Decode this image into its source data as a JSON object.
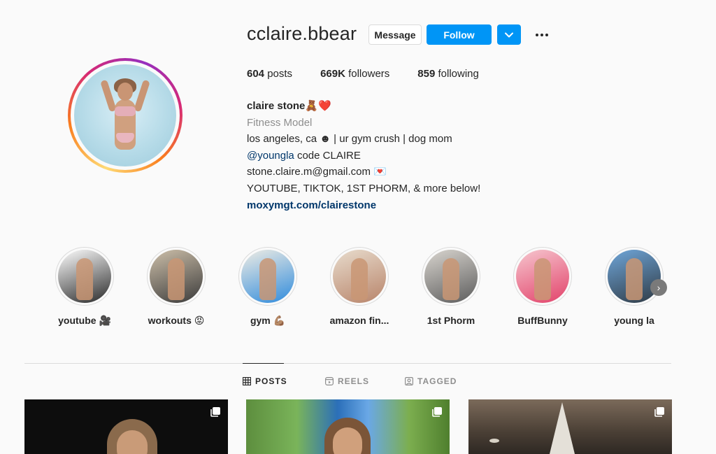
{
  "profile": {
    "username": "cclaire.bbear",
    "message_label": "Message",
    "follow_label": "Follow",
    "dropdown_icon": "chevron-down-icon",
    "more_icon": "more-options-icon"
  },
  "stats": {
    "posts_count": "604",
    "posts_label": "posts",
    "followers_count": "669K",
    "followers_label": "followers",
    "following_count": "859",
    "following_label": "following"
  },
  "bio": {
    "name": "claire stone🧸❤️",
    "category": "Fitness Model",
    "line1": "los angeles, ca ☻ | ur gym crush | dog mom",
    "mention": "@youngla",
    "mention_suffix": " code CLAIRE",
    "email": "stone.claire.m@gmail.com 💌",
    "line4": "YOUTUBE, TIKTOK, 1ST PHORM, & more below!",
    "link": "moxymgt.com/clairestone"
  },
  "highlights": [
    {
      "label": "youtube 🎥",
      "colors": [
        "#ffffff",
        "#2a2a2a"
      ]
    },
    {
      "label": "workouts 😡",
      "colors": [
        "#cdbfa9",
        "#3b3b3b"
      ]
    },
    {
      "label": "gym 💪🏽",
      "colors": [
        "#f0ede4",
        "#2f8bdc"
      ]
    },
    {
      "label": "amazon fin...",
      "colors": [
        "#e8dccd",
        "#b8846a"
      ]
    },
    {
      "label": "1st Phorm",
      "colors": [
        "#d9d5cf",
        "#5c5c5c"
      ]
    },
    {
      "label": "BuffBunny",
      "colors": [
        "#f6c7cf",
        "#e2426a"
      ]
    },
    {
      "label": "young la",
      "colors": [
        "#6fa6d9",
        "#2f3a44"
      ]
    }
  ],
  "tabs": {
    "posts": "POSTS",
    "reels": "REELS",
    "tagged": "TAGGED"
  },
  "colors": {
    "accent": "#0095f6",
    "link": "#00376b",
    "muted": "#8e8e8e"
  }
}
